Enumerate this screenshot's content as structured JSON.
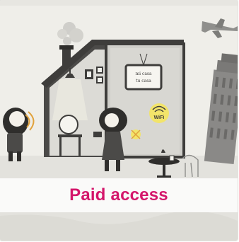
{
  "card": {
    "title": "Paid access",
    "title_color": "#d4166b"
  },
  "illustration": {
    "sign_text_line1": "mi casa",
    "sign_text_line2": "tu casa",
    "wifi_badge_text": "WiFi"
  },
  "icons": {
    "airplane": "airplane-icon",
    "tower": "leaning-tower-icon",
    "wifi": "wifi-icon"
  }
}
